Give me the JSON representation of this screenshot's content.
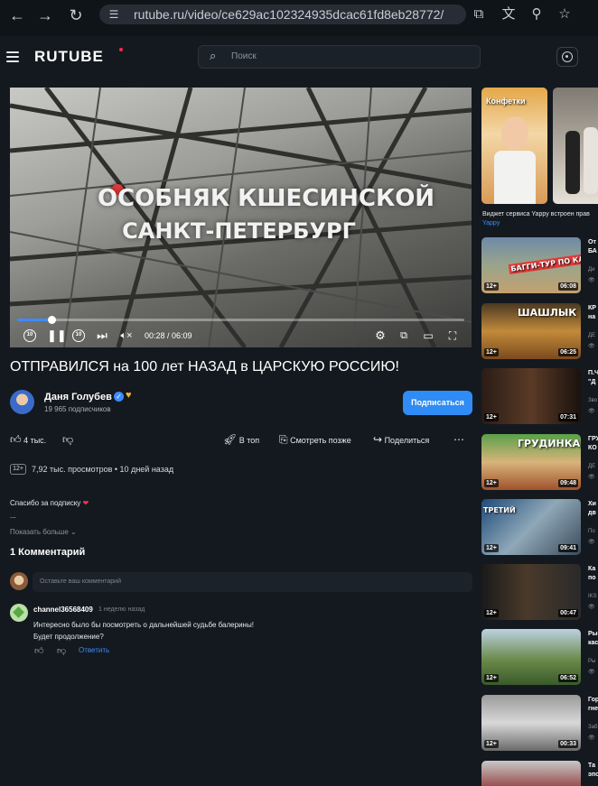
{
  "browser": {
    "url": "rutube.ru/video/ce629ac102324935dcac61fd8eb28772/",
    "icons": [
      "back-icon",
      "forward-icon",
      "reload-icon",
      "site-settings-icon",
      "open-in-app-icon",
      "translate-icon",
      "zoom-icon",
      "bookmark-star-icon"
    ]
  },
  "header": {
    "logo": "RUTUBE",
    "search_placeholder": "Поиск"
  },
  "player": {
    "overlay_line1": "ОСОБНЯК КШЕСИНСКОЙ",
    "overlay_line2": "САНКТ-ПЕТЕРБУРГ",
    "current_time": "00:28",
    "duration": "06:09",
    "time_text": "00:28 / 06:09",
    "progress": 0.076,
    "accent_color": "#3d8bfd",
    "rewind_label": "10",
    "forward_label": "10"
  },
  "video": {
    "title": "ОТПРАВИЛСЯ на 100 лет НАЗАД в ЦАРСКУЮ РОССИЮ!",
    "channel_name": "Даня Голубев",
    "subscribers": "19 965 подписчиков",
    "subscribe_label": "Подписаться",
    "likes": "4 тыс.",
    "to_top_label": "В топ",
    "watch_later_label": "Смотреть позже",
    "share_label": "Поделиться",
    "age_rating": "12+",
    "views_and_date": "7,92 тыс. просмотров  •  10 дней назад",
    "description": "Спасибо за подписку",
    "description_more": "...",
    "show_more_label": "Показать больше"
  },
  "comments": {
    "count_label": "1 Комментарий",
    "input_placeholder": "Оставьте ваш комментарий",
    "items": [
      {
        "user": "channel36568409",
        "time": "1 неделю назад",
        "line1": "Интересно было бы посмотреть о дальнейшей судьбе балерины!",
        "line2": "Будет продолжение?",
        "reply_label": "Ответить"
      }
    ]
  },
  "sidebar": {
    "yappy_caption": "Виджет сервиса Yappy встроен прав",
    "yappy_source": "Yappy",
    "yappy_card_text": "Конфетки",
    "videos": [
      {
        "title1": "От",
        "title2": "БА",
        "channel": "Ди",
        "duration": "06:08",
        "age": "12+",
        "thumb_text": "БАГГИ-ТУР ПО КАВКАЗУ"
      },
      {
        "title1": "КР",
        "title2": "на",
        "channel": "ДЕ",
        "duration": "06:25",
        "age": "12+",
        "thumb_text": "ШАШЛЫК"
      },
      {
        "title1": "П.Ч",
        "title2": "\"Д",
        "channel": "Зво",
        "duration": "07:31",
        "age": "12+",
        "thumb_text": ""
      },
      {
        "title1": "ГРУ",
        "title2": "КО",
        "channel": "ДЕ",
        "duration": "09:48",
        "age": "12+",
        "thumb_text": "ГРУДИНКА"
      },
      {
        "title1": "Хи",
        "title2": "дв",
        "channel": "По",
        "duration": "09:41",
        "age": "12+",
        "thumb_text": "ТРЕТИЙ"
      },
      {
        "title1": "Ка",
        "title2": "по",
        "channel": "IKS",
        "duration": "00:47",
        "age": "12+",
        "thumb_text": ""
      },
      {
        "title1": "Ры",
        "title2": "кас",
        "channel": "Ры",
        "duration": "06:52",
        "age": "12+",
        "thumb_text": ""
      },
      {
        "title1": "Гор",
        "title2": "гне",
        "channel": "Заб",
        "duration": "00:33",
        "age": "12+",
        "thumb_text": ""
      },
      {
        "title1": "Та",
        "title2": "эпо",
        "channel": "",
        "duration": "",
        "age": "",
        "thumb_text": ""
      }
    ]
  }
}
